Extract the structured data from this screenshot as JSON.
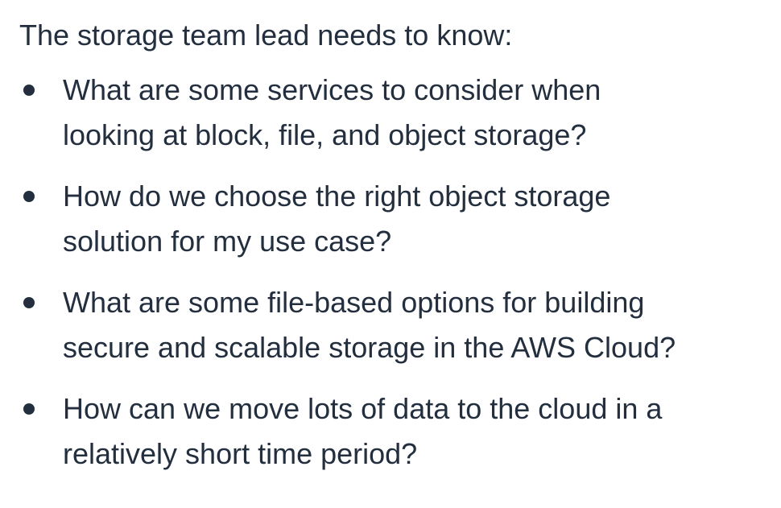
{
  "heading": "The storage team lead needs to know:",
  "bullets": [
    {
      "lines": [
        "What are some services to consider when",
        "looking at block, file, and object storage?"
      ]
    },
    {
      "lines": [
        "How do we choose the right object storage",
        "solution for my use case?"
      ]
    },
    {
      "lines": [
        "What are some file-based options for building",
        "secure and scalable storage in the AWS Cloud?"
      ]
    },
    {
      "lines": [
        "How can we move lots of data to the cloud in a",
        "relatively short time period?"
      ]
    }
  ],
  "colors": {
    "text": "#232f3e",
    "background": "#ffffff"
  }
}
